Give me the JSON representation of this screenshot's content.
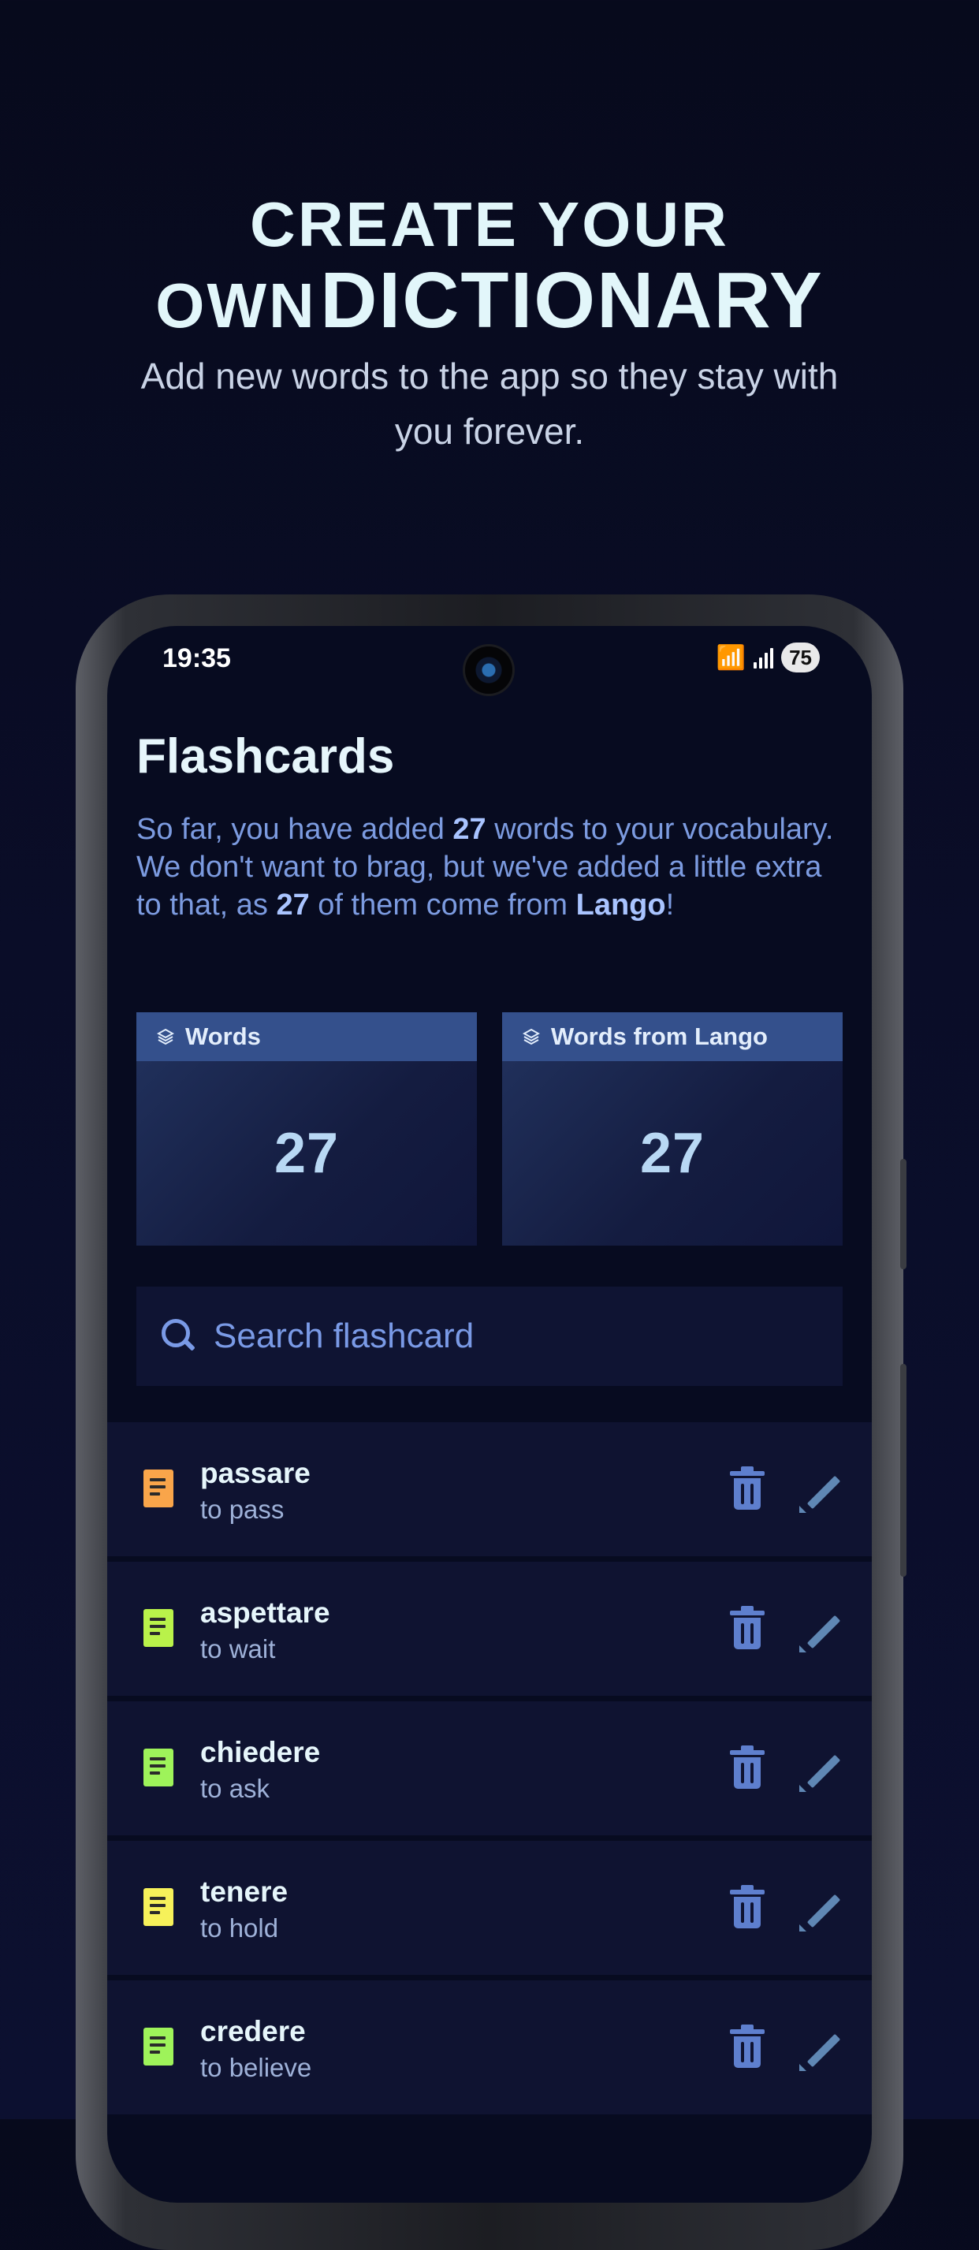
{
  "promo": {
    "headline_line1": "CREATE YOUR",
    "headline_line2_small": "OWN",
    "headline_line2_big": "DICTIONARY",
    "subtitle": "Add new words to the app so they stay with you forever."
  },
  "status_bar": {
    "time": "19:35",
    "battery": "75"
  },
  "screen": {
    "title": "Flashcards",
    "intro": {
      "part1": "So far, you have added ",
      "count1": "27",
      "part2": " words to your vocabulary. We don't want to brag, but we've added a little extra to that, as ",
      "count2": "27",
      "part3": " of them come from ",
      "brand": "Lango",
      "part4": "!"
    },
    "stats": [
      {
        "label": "Words",
        "value": "27"
      },
      {
        "label": "Words from Lango",
        "value": "27"
      }
    ],
    "search": {
      "placeholder": "Search flashcard"
    },
    "flashcards": [
      {
        "word": "passare",
        "translation": "to pass",
        "color": "#f9a54a"
      },
      {
        "word": "aspettare",
        "translation": "to wait",
        "color": "#b9f24a"
      },
      {
        "word": "chiedere",
        "translation": "to ask",
        "color": "#9ef35a"
      },
      {
        "word": "tenere",
        "translation": "to hold",
        "color": "#f6f15a"
      },
      {
        "word": "credere",
        "translation": "to believe",
        "color": "#9ef35a"
      }
    ]
  },
  "colors": {
    "accent_blue": "#7a9ae6",
    "card_header": "#34508c",
    "background": "#070a1c"
  }
}
